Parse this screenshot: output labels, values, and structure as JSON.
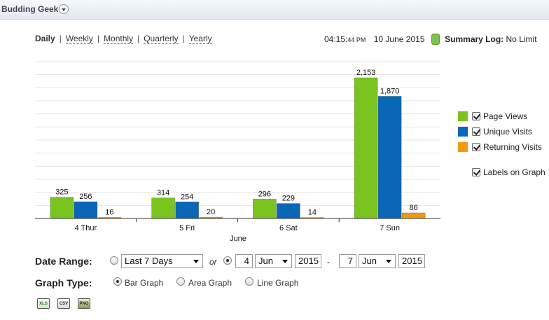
{
  "header": {
    "project_name": "Budding Geek"
  },
  "periods": {
    "items": [
      "Daily",
      "Weekly",
      "Monthly",
      "Quarterly",
      "Yearly"
    ],
    "active": "Daily"
  },
  "status": {
    "time": "04:15:",
    "time_small": "44 PM",
    "date": "10 June 2015",
    "log_label": "Summary Log:",
    "log_value": "No Limit"
  },
  "chart_data": {
    "type": "bar",
    "categories": [
      "4 Thur",
      "5 Fri",
      "6 Sat",
      "7 Sun"
    ],
    "xlabel": "June",
    "ylim": [
      0,
      2400
    ],
    "series": [
      {
        "name": "Page Views",
        "color": "#7ac41f",
        "values": [
          325,
          314,
          296,
          2153
        ]
      },
      {
        "name": "Unique Visits",
        "color": "#0a66b7",
        "values": [
          256,
          254,
          229,
          1870
        ]
      },
      {
        "name": "Returning Visits",
        "color": "#f09a12",
        "values": [
          16,
          20,
          14,
          86
        ]
      }
    ],
    "data_labels": [
      [
        "325",
        "256",
        "16"
      ],
      [
        "314",
        "254",
        "20"
      ],
      [
        "296",
        "229",
        "14"
      ],
      [
        "2,153",
        "1,870",
        "86"
      ]
    ],
    "grid": true,
    "legend": "right"
  },
  "legend": {
    "items": [
      {
        "label": "Page Views",
        "color": "#7ac41f",
        "checked": true
      },
      {
        "label": "Unique Visits",
        "color": "#0a66b7",
        "checked": true
      },
      {
        "label": "Returning Visits",
        "color": "#f09a12",
        "checked": true
      }
    ],
    "labels_on_graph": "Labels on Graph"
  },
  "date_range": {
    "label": "Date Range:",
    "preset": "Last 7 Days",
    "or_text": "or",
    "from_day": "4",
    "from_month": "Jun",
    "from_year": "2015",
    "dash": "-",
    "to_day": "7",
    "to_month": "Jun",
    "to_year": "2015"
  },
  "graph_type": {
    "label": "Graph Type:",
    "options": [
      "Bar Graph",
      "Area Graph",
      "Line Graph"
    ],
    "selected": "Bar Graph"
  },
  "export": {
    "xls": "XLS",
    "csv": "CSV",
    "png": "PNG"
  }
}
